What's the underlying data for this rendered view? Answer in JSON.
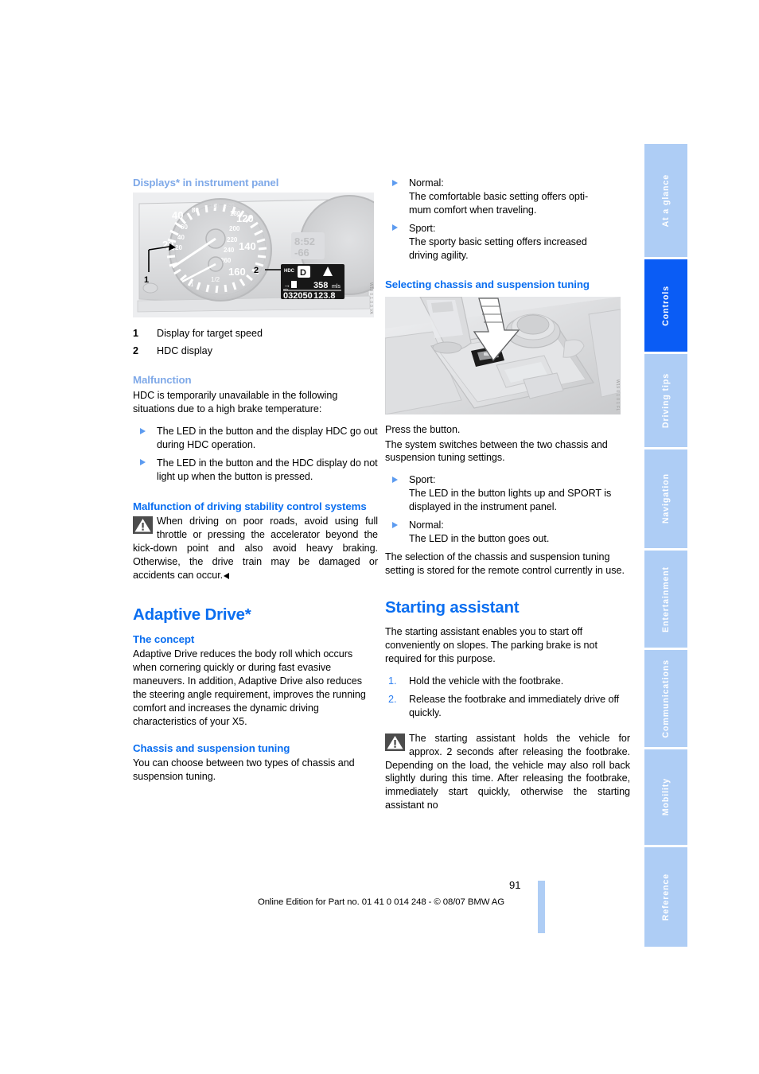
{
  "document": {
    "page_number": "91",
    "footer_text": "Online Edition for Part no. 01 41 0 014 248 - © 08/07 BMW AG"
  },
  "colors": {
    "heading_blue": "#0a6ef0",
    "heading_light_blue": "#7fa9e8",
    "tab_inactive": "#aecdf5",
    "tab_active": "#0a5cf5",
    "bullet_blue": "#5c9bf0"
  },
  "tabs": [
    {
      "label": "At a glance",
      "active": false
    },
    {
      "label": "Controls",
      "active": true
    },
    {
      "label": "Driving tips",
      "active": false
    },
    {
      "label": "Navigation",
      "active": false
    },
    {
      "label": "Entertainment",
      "active": false
    },
    {
      "label": "Communications",
      "active": false
    },
    {
      "label": "Mobility",
      "active": false
    },
    {
      "label": "Reference",
      "active": false
    }
  ],
  "left_column": {
    "displays_heading": "Displays* in instrument panel",
    "figure_cluster": {
      "name": "instrument-cluster-illustration",
      "code": "W19 0 1 0 0 VA",
      "callouts": [
        "1",
        "2"
      ],
      "display_values": {
        "clock": "8:52",
        "temperature": "-66",
        "gear": "D",
        "hdc_label": "HDC",
        "range": "358 mls",
        "odometer": "032050",
        "trip": "123.8",
        "speeds": [
          "20",
          "40",
          "120",
          "140",
          "160",
          "180",
          "200",
          "220",
          "240",
          "260"
        ],
        "fuel_mark": "1/2"
      }
    },
    "legend": [
      {
        "num": "1",
        "text": "Display for target speed"
      },
      {
        "num": "2",
        "text": "HDC display"
      }
    ],
    "malfunction_heading": "Malfunction",
    "malfunction_intro": "HDC is temporarily unavailable in the following situations due to a high brake temperature:",
    "malfunction_bullets": [
      "The LED in the button and the display HDC go out during HDC operation.",
      "The LED in the button and the HDC display do not light up when the button is pressed."
    ],
    "stability_heading": "Malfunction of driving stability control systems",
    "stability_note": "When driving on poor roads, avoid using full throttle or pressing the accelerator beyond the kick-down point and also avoid heavy braking. Otherwise, the drive train may be damaged or accidents can occur.",
    "adaptive_drive_heading": "Adaptive Drive*",
    "concept_heading": "The concept",
    "concept_text": "Adaptive Drive reduces the body roll which occurs when cornering quickly or during fast evasive maneuvers. In addition, Adaptive Drive also reduces the steering angle requirement, improves the running comfort and increases the dynamic driving characteristics of your X5.",
    "chassis_heading": "Chassis and suspension tuning",
    "chassis_text": "You can choose between two types of chassis and suspension tuning."
  },
  "right_column": {
    "tuning_bullets": [
      "Normal:\nThe comfortable basic setting offers optimum comfort when traveling.",
      "Sport:\nThe sporty basic setting offers increased driving agility."
    ],
    "tuning_bullet_1_line1": "Normal:",
    "tuning_bullet_1_line2": "The comfortable basic setting offers opti-",
    "tuning_bullet_1_line3": "mum comfort when traveling.",
    "tuning_bullet_2_line1": "Sport:",
    "tuning_bullet_2_line2": "The sporty basic setting offers increased",
    "tuning_bullet_2_line3": "driving agility.",
    "selecting_heading": "Selecting chassis and suspension tuning",
    "figure_console": {
      "name": "center-console-button-illustration",
      "code": "W19 0 1 0 1 FL"
    },
    "press_button": "Press the button.",
    "press_button_detail": "The system switches between the two chassis and suspension tuning settings.",
    "sport_label": "Sport:",
    "sport_text": "The LED in the button lights up and SPORT is displayed in the instrument panel.",
    "normal_label": "Normal:",
    "normal_text": "The LED in the button goes out.",
    "selection_stored": "The selection of the chassis and suspension tuning setting is stored for the remote control currently in use.",
    "starting_assistant_heading": "Starting assistant",
    "starting_assistant_intro": "The starting assistant enables you to start off conveniently on slopes. The parking brake is not required for this purpose.",
    "steps": [
      {
        "num": "1.",
        "text": "Hold the vehicle with the footbrake."
      },
      {
        "num": "2.",
        "text": "Release the footbrake and immediately drive off quickly."
      }
    ],
    "assistant_note": "The starting assistant holds the vehicle for approx. 2 seconds after releasing the footbrake. Depending on the load, the vehicle may also roll back slightly during this time. After releasing the footbrake, immediately start quickly, otherwise the starting assistant no"
  }
}
